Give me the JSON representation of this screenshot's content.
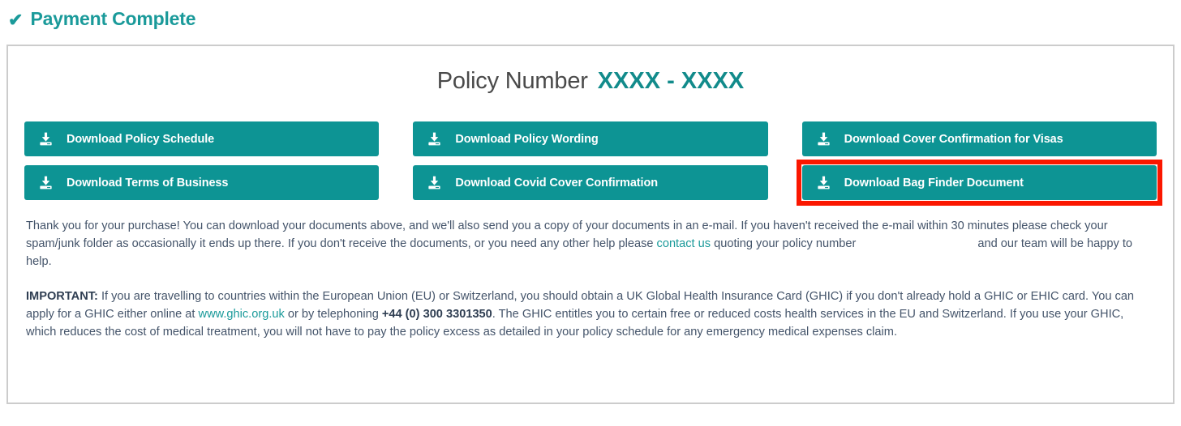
{
  "header": {
    "check_icon": "check-icon",
    "title": "Payment Complete"
  },
  "card": {
    "policy": {
      "label": "Policy Number",
      "value": "XXXX - XXXX"
    },
    "buttons": [
      {
        "icon": "download-icon",
        "label": "Download Policy Schedule",
        "highlighted": false
      },
      {
        "icon": "download-icon",
        "label": "Download Policy Wording",
        "highlighted": false
      },
      {
        "icon": "download-icon",
        "label": "Download Cover Confirmation for Visas",
        "highlighted": false
      },
      {
        "icon": "download-icon",
        "label": "Download Terms of Business",
        "highlighted": false
      },
      {
        "icon": "download-icon",
        "label": "Download Covid Cover Confirmation",
        "highlighted": false
      },
      {
        "icon": "download-icon",
        "label": "Download Bag Finder Document",
        "highlighted": true
      }
    ],
    "paragraph_one": {
      "part_1": "Thank you for your purchase! You can download your documents above, and we'll also send you a copy of your documents in an e-mail. If you haven't received the e-mail within 30 minutes please check your spam/junk folder as occasionally it ends up there. If you don't receive the documents, or you need any other help please ",
      "link": "contact us",
      "part_2": " quoting your policy number",
      "part_3": "and our team will be happy to help."
    },
    "paragraph_two": {
      "important": "IMPORTANT:",
      "part_1": " If you are travelling to countries within the European Union (EU) or Switzerland, you should obtain a UK Global Health Insurance Card (GHIC) if you don't already hold a GHIC or EHIC card. You can apply for a GHIC either online at ",
      "link": "www.ghic.org.uk",
      "part_2": " or by telephoning ",
      "phone": "+44 (0) 300 3301350",
      "part_3": ". The GHIC entitles you to certain free or reduced costs health services in the EU and Switzerland. If you use your GHIC, which reduces the cost of medical treatment, you will not have to pay the policy excess as detailed in your policy schedule for any emergency medical expenses claim."
    }
  },
  "colors": {
    "teal": "#0d9494",
    "teal_text": "#1a9a9a",
    "highlight_red": "#fb1700",
    "body_text": "#44546a",
    "card_border": "#cccccc"
  }
}
